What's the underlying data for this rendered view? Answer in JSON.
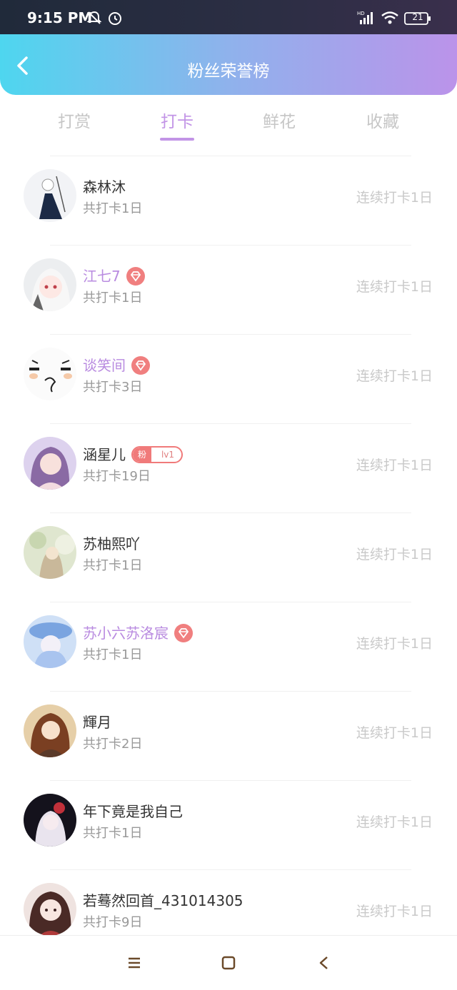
{
  "status": {
    "time": "9:15 PM",
    "battery": "21"
  },
  "header": {
    "title": "粉丝荣誉榜"
  },
  "tabs": [
    {
      "label": "打赏"
    },
    {
      "label": "打卡"
    },
    {
      "label": "鲜花"
    },
    {
      "label": "收藏"
    }
  ],
  "active_tab": "打卡",
  "rows": [
    {
      "name": "森林沐",
      "total": "共打卡1日",
      "streak": "连续打卡1日"
    },
    {
      "name": "江七7",
      "total": "共打卡1日",
      "streak": "连续打卡1日"
    },
    {
      "name": "谈笑间",
      "total": "共打卡3日",
      "streak": "连续打卡1日"
    },
    {
      "name": "涵星儿",
      "total": "共打卡19日",
      "streak": "连续打卡1日",
      "fan_badge": {
        "left": "粉",
        "right": "lv1"
      }
    },
    {
      "name": "苏柚熙吖",
      "total": "共打卡1日",
      "streak": "连续打卡1日"
    },
    {
      "name": "苏小六苏洛宸",
      "total": "共打卡1日",
      "streak": "连续打卡1日"
    },
    {
      "name": "輝月",
      "total": "共打卡2日",
      "streak": "连续打卡1日"
    },
    {
      "name": "年下竟是我自己",
      "total": "共打卡1日",
      "streak": "连续打卡1日"
    },
    {
      "name": "若蓦然回首_431014305",
      "total": "共打卡9日",
      "streak": "连续打卡1日"
    }
  ]
}
